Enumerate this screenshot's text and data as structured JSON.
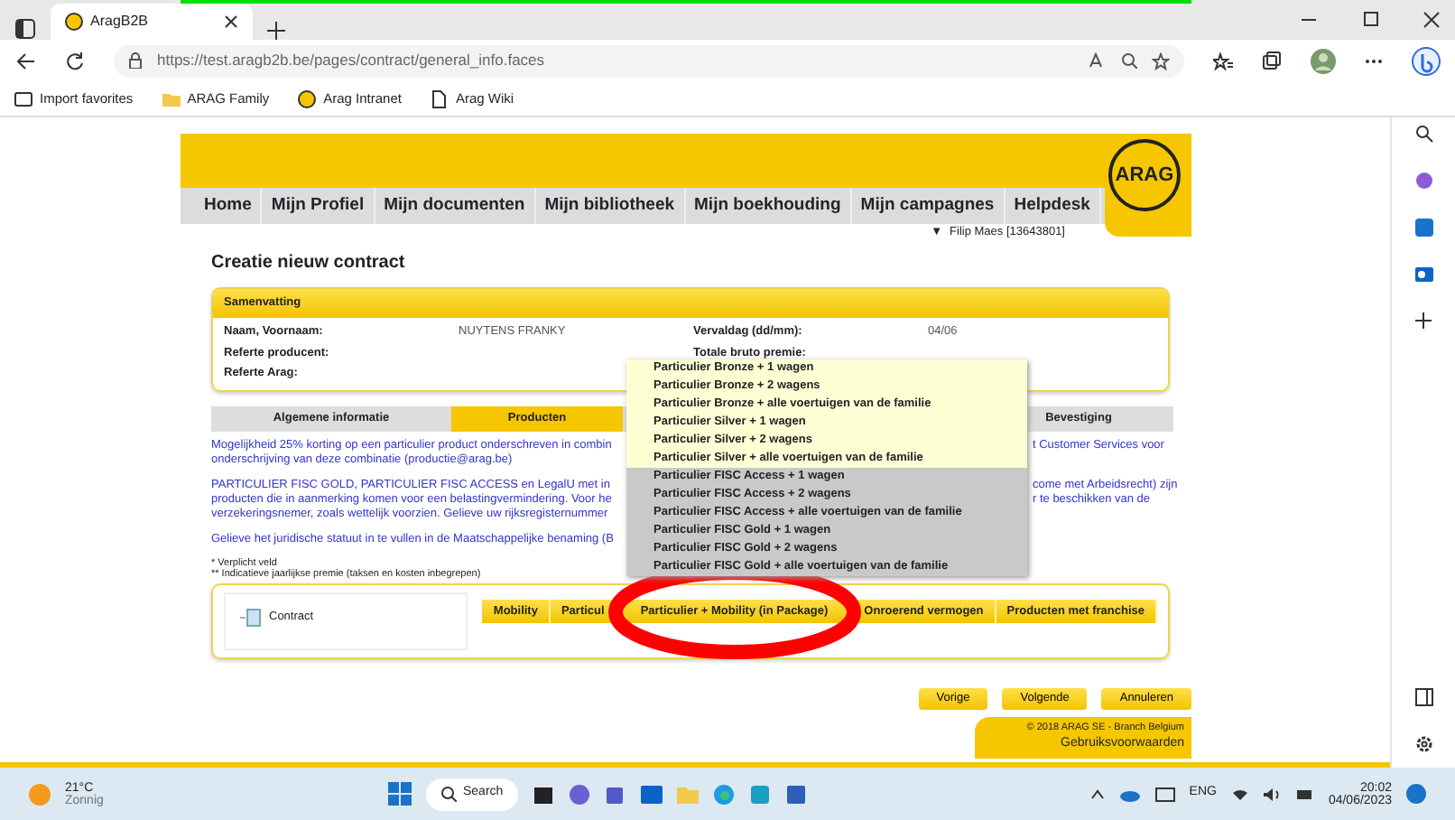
{
  "browser": {
    "tab_title": "AragB2B",
    "url": "https://test.aragb2b.be/pages/contract/general_info.faces",
    "favorites": [
      {
        "label": "Import favorites",
        "kind": "import"
      },
      {
        "label": "ARAG Family",
        "kind": "folder"
      },
      {
        "label": "Arag Intranet",
        "kind": "site"
      },
      {
        "label": "Arag Wiki",
        "kind": "page"
      }
    ]
  },
  "app": {
    "logo": "ARAG",
    "nav": [
      "Home",
      "Mijn Profiel",
      "Mijn documenten",
      "Mijn bibliotheek",
      "Mijn boekhouding",
      "Mijn campagnes",
      "Helpdesk"
    ],
    "user": "Filip Maes [13643801]",
    "user_marker": "▼",
    "page_title": "Creatie nieuw contract",
    "summary": {
      "title": "Samenvatting",
      "fields": [
        {
          "label": "Naam, Voornaam:",
          "value": "NUYTENS FRANKY"
        },
        {
          "label": "Vervaldag (dd/mm):",
          "value": "04/06"
        },
        {
          "label": "Referte producent:"
        },
        {
          "label": "Totale bruto premie:"
        },
        {
          "label": "Referte Arag:"
        }
      ]
    },
    "steps": [
      {
        "label": "Algemene informatie",
        "selected": false
      },
      {
        "label": "Producten",
        "selected": true
      },
      {
        "label": "Bevestiging",
        "selected": false
      }
    ],
    "paragraphs": [
      {
        "lines": [
          {
            "left": "Mogelijkheid 25% korting op een particulier product onderschreven in combin",
            "right": "t Customer Services voor"
          },
          {
            "left": "onderschrijving van deze combinatie (productie@arag.be)"
          }
        ]
      },
      {
        "lines": [
          {
            "left": "PARTICULIER FISC GOLD, PARTICULIER FISC ACCESS en LegalU met in",
            "right": "come met Arbeidsrecht) zijn"
          },
          {
            "left": "producten die in aanmerking komen voor een belastingvermindering. Voor he",
            "right": "r te beschikken van de"
          },
          {
            "left": "verzekeringsnemer, zoals wettelijk voorzien. Gelieve uw rijksregisternummer"
          }
        ]
      },
      {
        "lines": [
          {
            "left": "Gelieve het juridische statuut in te vullen in de Maatschappelijke benaming (B"
          }
        ]
      }
    ],
    "footnotes": [
      "* Verplicht veld",
      "** Indicatieve jaarlijkse premie (taksen en kosten inbegrepen)"
    ],
    "tree": [
      "Contract"
    ],
    "product_tabs": [
      {
        "label": "Mobility",
        "circled": false
      },
      {
        "label": "Particul",
        "circled": false
      },
      {
        "label": "Particulier + Mobility (in Package)",
        "circled": true
      },
      {
        "label": "Onroerend vermogen",
        "circled": false
      },
      {
        "label": "Producten met franchise",
        "circled": false
      }
    ],
    "dropdown": [
      {
        "label": "Particulier Bronze + 1 wagen",
        "shaded": false
      },
      {
        "label": "Particulier Bronze + 2 wagens",
        "shaded": false
      },
      {
        "label": "Particulier Bronze + alle voertuigen van de familie",
        "shaded": false
      },
      {
        "label": "Particulier Silver + 1 wagen",
        "shaded": false
      },
      {
        "label": "Particulier Silver + 2 wagens",
        "shaded": false
      },
      {
        "label": "Particulier Silver + alle voertuigen van de familie",
        "shaded": false
      },
      {
        "label": "Particulier FISC Access + 1 wagen",
        "shaded": true
      },
      {
        "label": "Particulier FISC Access + 2 wagens",
        "shaded": true
      },
      {
        "label": "Particulier FISC Access + alle voertuigen van de familie",
        "shaded": true
      },
      {
        "label": "Particulier FISC Gold + 1 wagen",
        "shaded": true
      },
      {
        "label": "Particulier FISC Gold + 2 wagens",
        "shaded": true
      },
      {
        "label": "Particulier FISC Gold + alle voertuigen van de familie",
        "shaded": true
      }
    ],
    "buttons": [
      "Vorige",
      "Volgende",
      "Annuleren"
    ],
    "footer": {
      "copyright": "© 2018 ARAG SE - Branch Belgium",
      "link": "Gebruiksvoorwaarden"
    },
    "annotation": {
      "kind": "ellipse"
    }
  },
  "taskbar": {
    "temperature": "21°C",
    "condition": "Zonnig",
    "search": "Search",
    "language": "ENG",
    "time": "20:02",
    "date": "04/06/2023"
  }
}
